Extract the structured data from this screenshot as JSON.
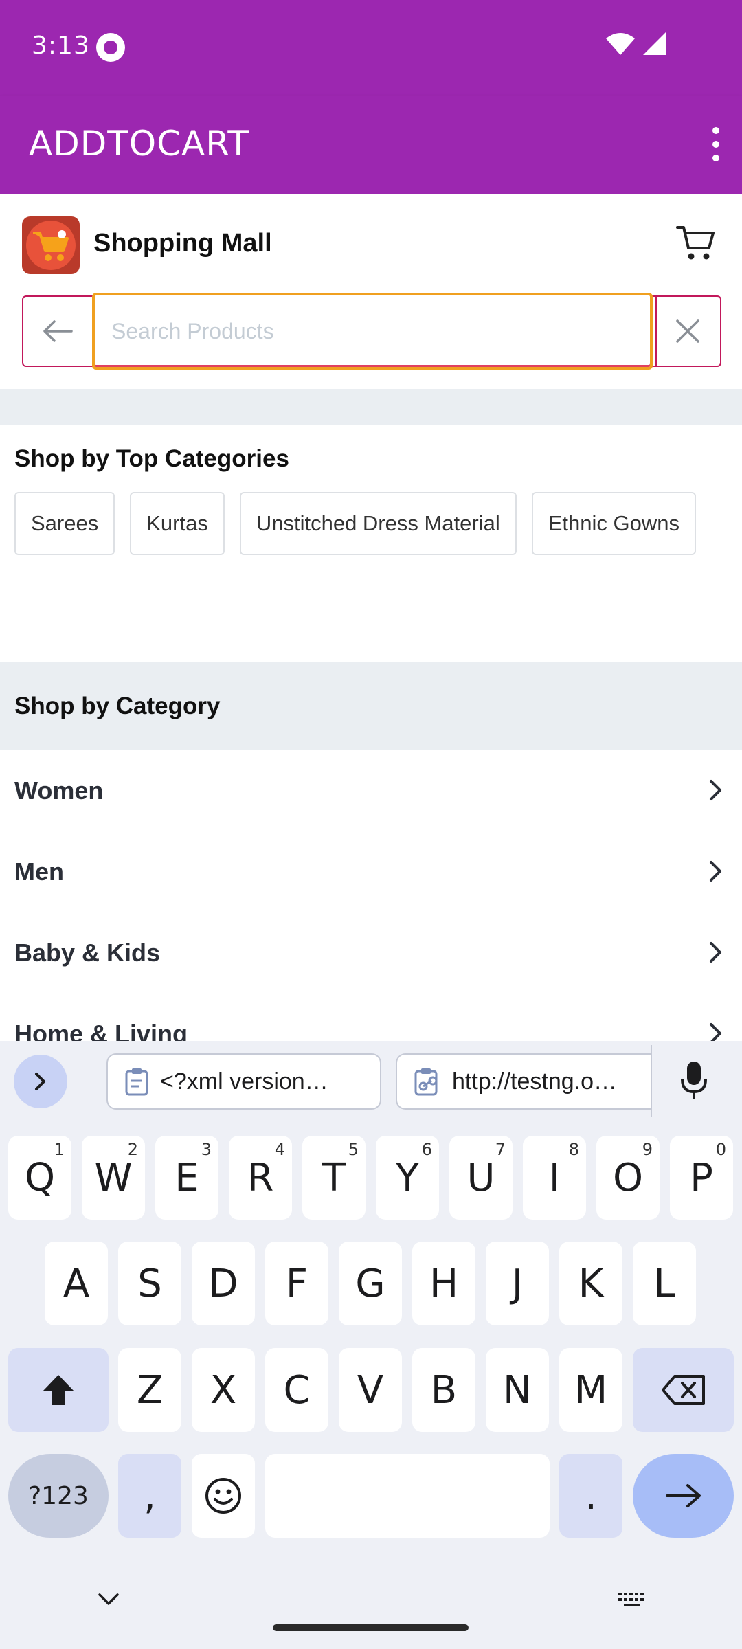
{
  "status_bar": {
    "time": "3:13"
  },
  "app_bar": {
    "title": "ADDTOCART"
  },
  "store": {
    "name": "Shopping Mall"
  },
  "search": {
    "placeholder": "Search Products",
    "value": ""
  },
  "top_categories": {
    "title": "Shop by Top Categories",
    "chips": [
      "Sarees",
      "Kurtas",
      "Unstitched Dress Material",
      "Ethnic Gowns"
    ]
  },
  "categories": {
    "title": "Shop by Category",
    "items": [
      "Women",
      "Men",
      "Baby & Kids",
      "Home & Living"
    ]
  },
  "keyboard": {
    "clipboard": [
      "<?xml version…",
      "http://testng.o…"
    ],
    "row1": [
      {
        "key": "Q",
        "hint": "1"
      },
      {
        "key": "W",
        "hint": "2"
      },
      {
        "key": "E",
        "hint": "3"
      },
      {
        "key": "R",
        "hint": "4"
      },
      {
        "key": "T",
        "hint": "5"
      },
      {
        "key": "Y",
        "hint": "6"
      },
      {
        "key": "U",
        "hint": "7"
      },
      {
        "key": "I",
        "hint": "8"
      },
      {
        "key": "O",
        "hint": "9"
      },
      {
        "key": "P",
        "hint": "0"
      }
    ],
    "row2": [
      "A",
      "S",
      "D",
      "F",
      "G",
      "H",
      "J",
      "K",
      "L"
    ],
    "row3": [
      "Z",
      "X",
      "C",
      "V",
      "B",
      "N",
      "M"
    ],
    "symbols_label": "?123",
    "comma": ",",
    "period": "."
  },
  "colors": {
    "primary": "#9c27b0",
    "search_border": "#c2185b",
    "focus": "#f0a020"
  }
}
